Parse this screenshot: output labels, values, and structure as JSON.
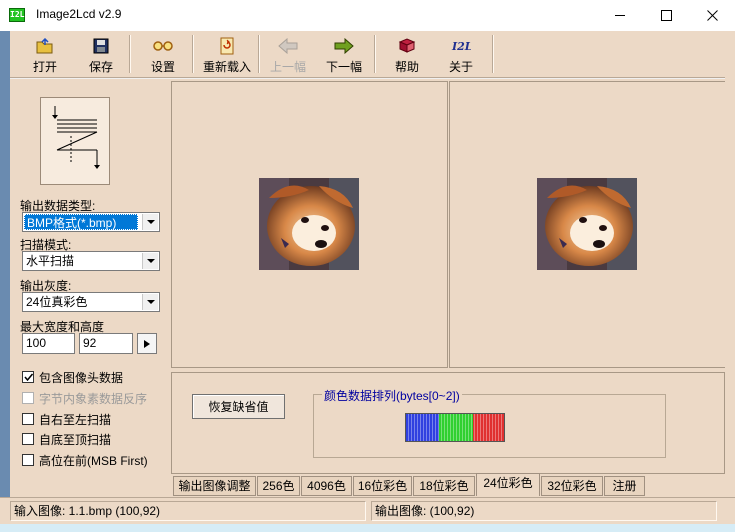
{
  "window": {
    "title": "Image2Lcd v2.9",
    "icon_text": "I2L"
  },
  "toolbar": {
    "open": "打开",
    "save": "保存",
    "settings": "设置",
    "reload": "重新载入",
    "prev": "上一幅",
    "next": "下一幅",
    "help": "帮助",
    "about": "关于"
  },
  "left": {
    "output_type_label": "输出数据类型:",
    "output_type_value": "BMP格式(*.bmp)",
    "scan_mode_label": "扫描模式:",
    "scan_mode_value": "水平扫描",
    "gray_label": "输出灰度:",
    "gray_value": "24位真彩色",
    "size_label": "最大宽度和高度",
    "max_width": "100",
    "max_height": "92",
    "checkboxes": [
      {
        "label": "包含图像头数据",
        "checked": true,
        "enabled": true
      },
      {
        "label": "字节内象素数据反序",
        "checked": false,
        "enabled": false
      },
      {
        "label": "自右至左扫描",
        "checked": false,
        "enabled": true
      },
      {
        "label": "自底至顶扫描",
        "checked": false,
        "enabled": true
      },
      {
        "label": "高位在前(MSB First)",
        "checked": false,
        "enabled": true
      }
    ]
  },
  "bottom": {
    "restore_button": "恢复缺省值",
    "group_title": "颜色数据排列(bytes[0~2])"
  },
  "tabs": [
    "输出图像调整",
    "256色",
    "4096色",
    "16位彩色",
    "18位彩色",
    "24位彩色",
    "32位彩色",
    "注册"
  ],
  "active_tab": "24位彩色",
  "status": {
    "input": "输入图像: 1.1.bmp (100,92)",
    "output": "输出图像: (100,92)"
  },
  "colors": {
    "panel": "#ecd9c6",
    "swatch_blue": "#3040e0",
    "swatch_green": "#30d030",
    "swatch_red": "#e03030"
  }
}
